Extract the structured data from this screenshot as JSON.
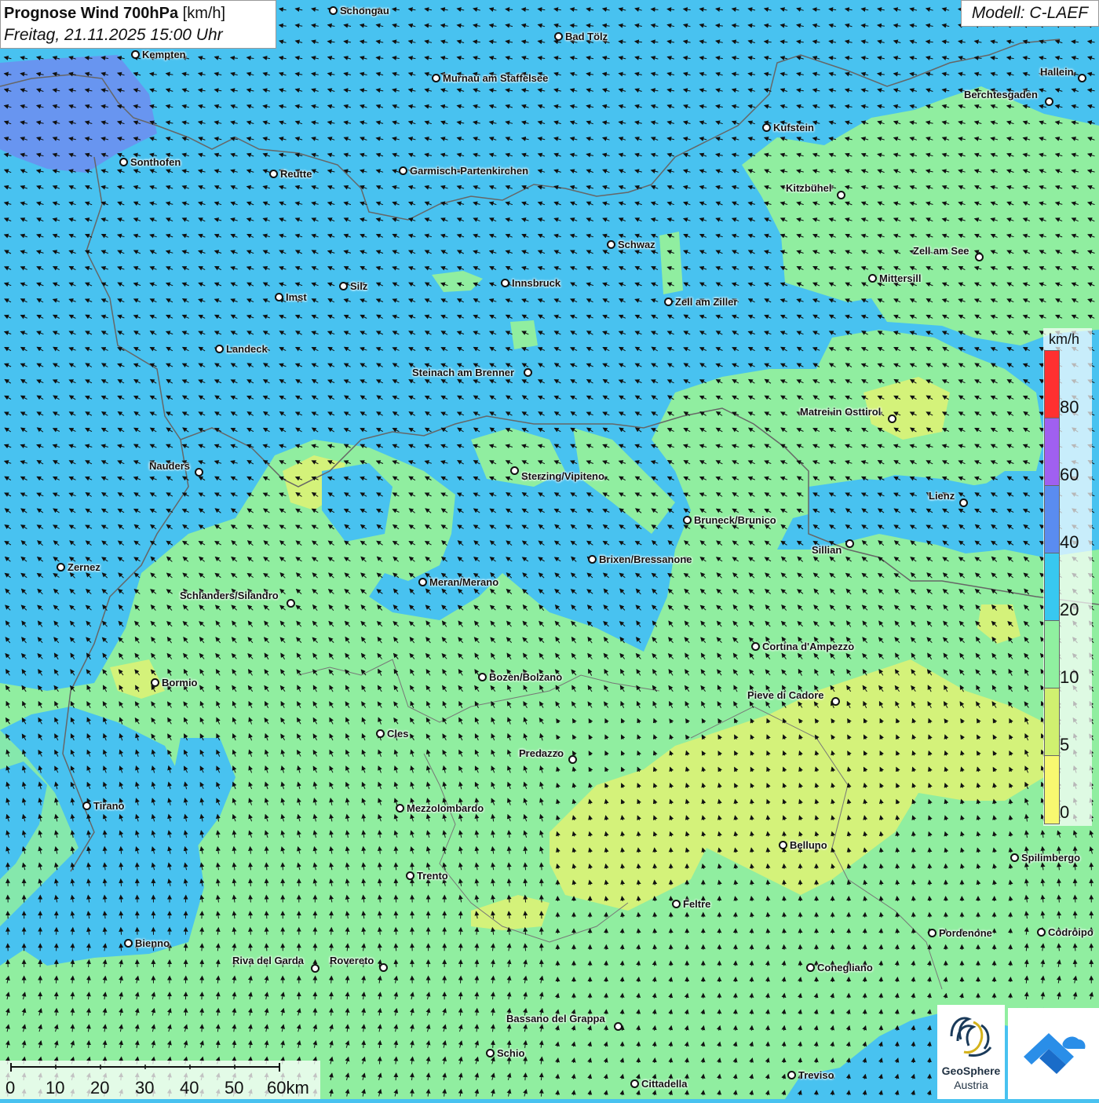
{
  "header": {
    "title_bold": "Prognose Wind 700hPa",
    "title_unit": "[km/h]",
    "date": "Freitag, 21.11.2025 15:00 Uhr",
    "model": "Modell: C-LAEF"
  },
  "legend": {
    "unit": "km/h",
    "labels": [
      "80",
      "60",
      "40",
      "20",
      "10",
      "5",
      "0"
    ],
    "colors": [
      "#ff3030",
      "#a060f0",
      "#5a8cf0",
      "#38c8f0",
      "#90f0a0",
      "#d0f070",
      "#f8f870"
    ]
  },
  "scale": {
    "labels": [
      "0",
      "10",
      "20",
      "30",
      "40",
      "50",
      "60km"
    ]
  },
  "logos": {
    "geosphere_line1": "GeoSphere",
    "geosphere_line2": "Austria"
  },
  "cities": [
    {
      "name": "Schongau"
    },
    {
      "name": "Bad Tölz"
    },
    {
      "name": "Kempten"
    },
    {
      "name": "Hallein"
    },
    {
      "name": "Murnau am Staffelsee"
    },
    {
      "name": "Berchtesgaden"
    },
    {
      "name": "Kufstein"
    },
    {
      "name": "Sonthofen"
    },
    {
      "name": "Reutte"
    },
    {
      "name": "Garmisch-Partenkirchen"
    },
    {
      "name": "Kitzbühel"
    },
    {
      "name": "Schwaz"
    },
    {
      "name": "Zell am See"
    },
    {
      "name": "Mittersill"
    },
    {
      "name": "Innsbruck"
    },
    {
      "name": "Silz"
    },
    {
      "name": "Imst"
    },
    {
      "name": "Zell am Ziller"
    },
    {
      "name": "Landeck"
    },
    {
      "name": "Steinach am Brenner"
    },
    {
      "name": "Matrei in Osttirol"
    },
    {
      "name": "Nauders"
    },
    {
      "name": "Sterzing/Vipiteno"
    },
    {
      "name": "Lienz"
    },
    {
      "name": "Bruneck/Brunico"
    },
    {
      "name": "Sillian"
    },
    {
      "name": "Brixen/Bressanone"
    },
    {
      "name": "Zernez"
    },
    {
      "name": "Meran/Merano"
    },
    {
      "name": "Schlanders/Silandro"
    },
    {
      "name": "Cortina d'Ampezzo"
    },
    {
      "name": "Bozen/Bolzano"
    },
    {
      "name": "Bormio"
    },
    {
      "name": "Pieve di Cadore"
    },
    {
      "name": "Cles"
    },
    {
      "name": "Predazzo"
    },
    {
      "name": "Tirano"
    },
    {
      "name": "Mezzolombardo"
    },
    {
      "name": "Belluno"
    },
    {
      "name": "Spilimbergo"
    },
    {
      "name": "Trento"
    },
    {
      "name": "Feltre"
    },
    {
      "name": "Pordenone"
    },
    {
      "name": "Codroipo"
    },
    {
      "name": "Bienno"
    },
    {
      "name": "Riva del Garda"
    },
    {
      "name": "Rovereto"
    },
    {
      "name": "Conegliano"
    },
    {
      "name": "Bassano del Grappa"
    },
    {
      "name": "Schio"
    },
    {
      "name": "Treviso"
    },
    {
      "name": "Cittadella"
    }
  ]
}
